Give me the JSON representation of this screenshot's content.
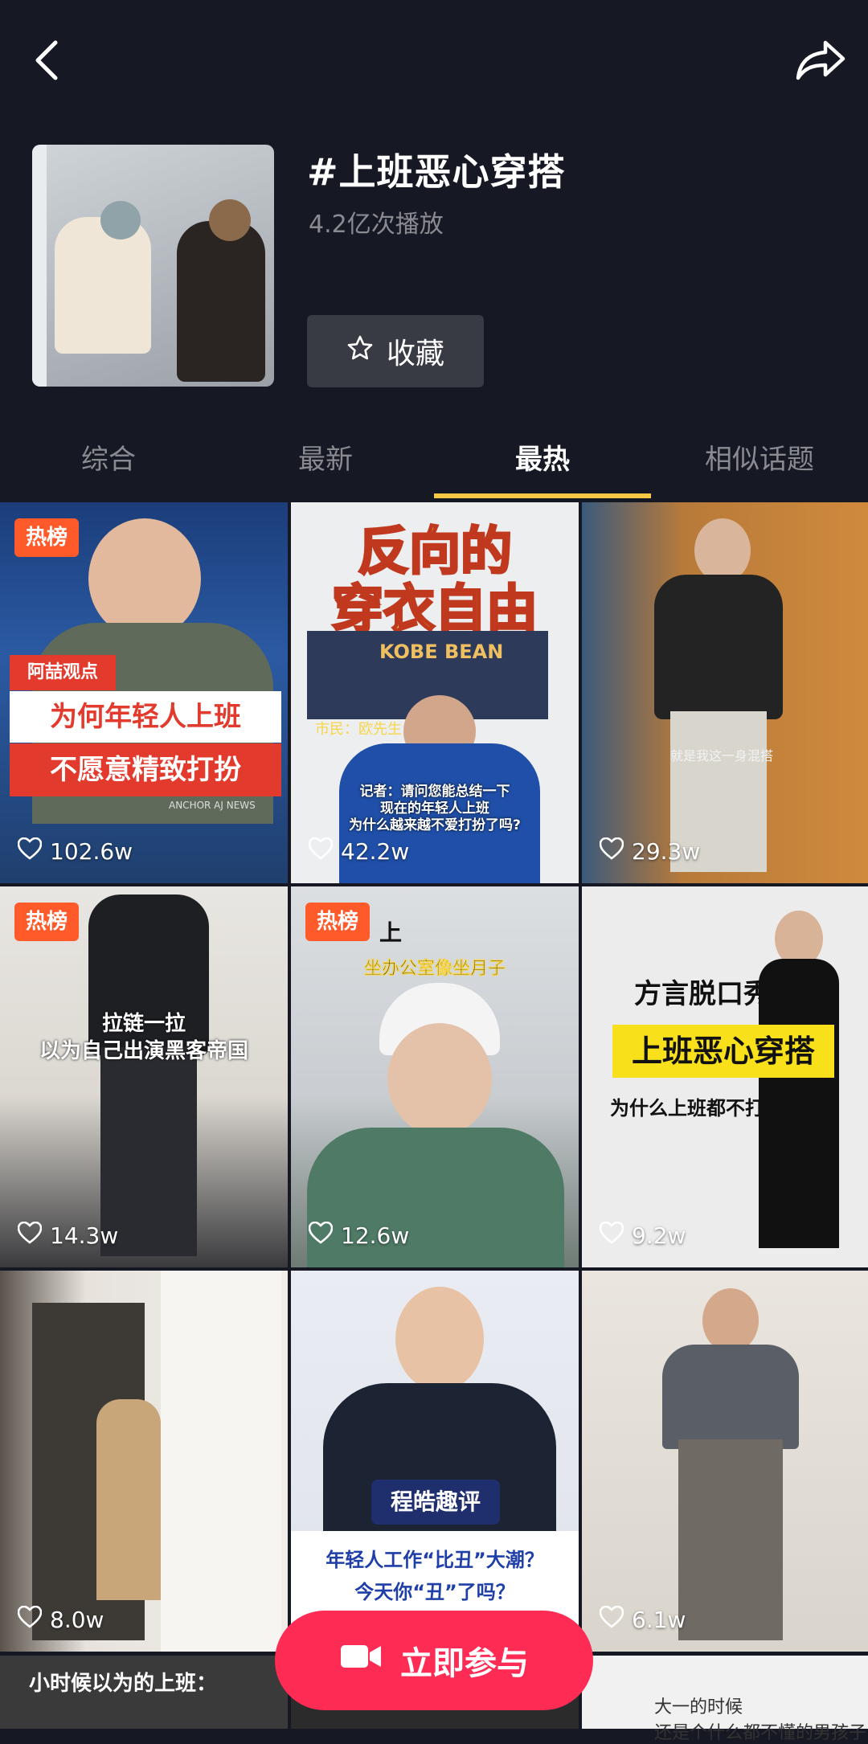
{
  "header": {
    "title": "#上班恶心穿搭",
    "plays": "4.2亿次播放",
    "favorite_label": "收藏"
  },
  "tabs": [
    "综合",
    "最新",
    "最热",
    "相似话题"
  ],
  "active_tab": "最热",
  "videos": [
    {
      "likes": "102.6w",
      "hot": "热榜",
      "lines": [
        "阿喆观点",
        "为何年轻人上班",
        "不愿意精致打扮",
        "ANCHOR AJ NEWS"
      ]
    },
    {
      "likes": "42.2w",
      "lines": [
        "反向的",
        "穿衣自由",
        "KOBE BEAN",
        "市民：欧先生",
        "记者：请问您能总结一下",
        "现在的年轻人上班",
        "为什么越来越不爱打扮了吗?"
      ]
    },
    {
      "likes": "29.3w",
      "lines": [
        "就是我这一身混搭"
      ]
    },
    {
      "likes": "14.3w",
      "hot": "热榜",
      "lines": [
        "拉链一拉",
        "以为自己出演黑客帝国"
      ]
    },
    {
      "likes": "12.6w",
      "hot": "热榜",
      "lines": [
        "上",
        "坐办公室像坐月子"
      ]
    },
    {
      "likes": "9.2w",
      "lines": [
        "方言脱口秀",
        "上班恶心穿搭",
        "为什么上班都不打扮?"
      ]
    },
    {
      "likes": "8.0w",
      "lines": []
    },
    {
      "likes": "",
      "lines": [
        "程皓趣评",
        "年轻人工作“比丑”大潮？",
        "今天你“丑”了吗？"
      ]
    },
    {
      "likes": "6.1w",
      "lines": []
    }
  ],
  "partial_row": [
    "小时候以为的上班：",
    "大一的时候",
    "还是个什么都不懂的男孩子"
  ],
  "join_label": "立即参与",
  "colors": {
    "background": "#161823",
    "accent": "#fe2c55",
    "tab_underline": "#f6c843",
    "hot_badge": "#ff5a2a"
  }
}
